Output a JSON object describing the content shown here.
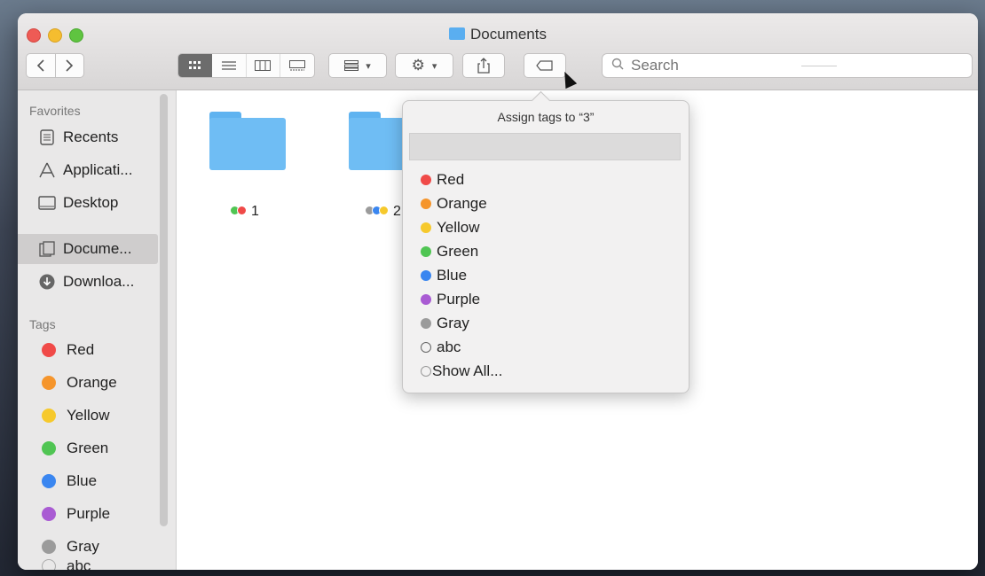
{
  "window": {
    "title": "Documents",
    "traffic_lights": [
      "close",
      "minimize",
      "zoom"
    ]
  },
  "toolbar": {
    "back_icon": "chevron-left-icon",
    "forward_icon": "chevron-right-icon",
    "view_modes": [
      "icon-view",
      "list-view",
      "column-view",
      "gallery-view"
    ],
    "selected_view": "icon-view",
    "group_icon": "group-icon",
    "action_icon": "gear-icon",
    "share_icon": "share-icon",
    "tag_icon": "tag-icon",
    "search_placeholder": "Search"
  },
  "sidebar": {
    "favorites_header": "Favorites",
    "favorites": [
      {
        "label": "Recents",
        "icon": "recents-icon",
        "selected": false
      },
      {
        "label": "Applicati...",
        "icon": "applications-icon",
        "selected": false
      },
      {
        "label": "Desktop",
        "icon": "desktop-icon",
        "selected": false
      },
      {
        "label": "Docume...",
        "icon": "documents-icon",
        "selected": true
      },
      {
        "label": "Downloa...",
        "icon": "downloads-icon",
        "selected": false
      }
    ],
    "tags_header": "Tags",
    "tags": [
      {
        "label": "Red",
        "color": "#f04a48"
      },
      {
        "label": "Orange",
        "color": "#f5952c"
      },
      {
        "label": "Yellow",
        "color": "#f6c92c"
      },
      {
        "label": "Green",
        "color": "#50c553"
      },
      {
        "label": "Blue",
        "color": "#3a86f0"
      },
      {
        "label": "Purple",
        "color": "#a95bd3"
      },
      {
        "label": "Gray",
        "color": "#9b9b9b"
      },
      {
        "label": "abc",
        "color": ""
      }
    ]
  },
  "files": [
    {
      "name": "1",
      "tag_colors": [
        "#50c553",
        "#f04a48"
      ]
    },
    {
      "name": "2",
      "tag_colors": [
        "#9b9b9b",
        "#3a86f0",
        "#f6c92c"
      ]
    }
  ],
  "popover": {
    "title": "Assign tags to “3”",
    "input_value": "",
    "items": [
      {
        "label": "Red",
        "color": "#f04a48"
      },
      {
        "label": "Orange",
        "color": "#f5952c"
      },
      {
        "label": "Yellow",
        "color": "#f6c92c"
      },
      {
        "label": "Green",
        "color": "#50c553"
      },
      {
        "label": "Blue",
        "color": "#3a86f0"
      },
      {
        "label": "Purple",
        "color": "#a95bd3"
      },
      {
        "label": "Gray",
        "color": "#9b9b9b"
      },
      {
        "label": "abc",
        "color": ""
      },
      {
        "label": "Show All...",
        "color": ""
      }
    ]
  }
}
